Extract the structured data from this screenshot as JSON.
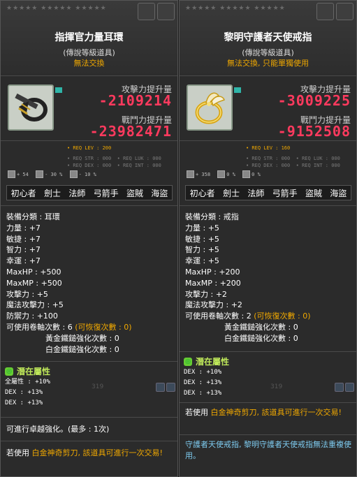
{
  "left": {
    "stars": "★★★★★ ★★★★★ ★★★★★",
    "title": "指揮官力量耳環",
    "grade": "(傳說等級道具)",
    "trade": "無法交換",
    "atk_label": "攻擊力提升量",
    "atk_value": "-2109214",
    "power_label": "戰鬥力提升量",
    "power_value": "-23982471",
    "req_lev": "• REQ LEV : 200",
    "reqs": "• REQ STR : 000  • REQ LUK : 000\n• REQ DEX : 000  • REQ INT : 000",
    "mod1": "+ 54",
    "mod2": "- 30 %",
    "mod3": "- 10 %",
    "jobs": [
      "初心者",
      "劍士",
      "法師",
      "弓箭手",
      "盜賊",
      "海盜"
    ],
    "stats": [
      "裝備分類 : 耳環",
      "力量 : +7",
      "敏捷 : +7",
      "智力 : +7",
      "幸運 : +7",
      "MaxHP : +500",
      "MaxMP : +500",
      "攻擊力 : +5",
      "魔法攻擊力 : +5",
      "防禦力 : +100"
    ],
    "scroll_label": "可使用卷軸次數 : 6 ",
    "scroll_extra": "(可恢復次數 : 0)",
    "gold_hammer": "黃金鐵鎚強化次數 : 0",
    "plat_hammer": "白金鐵鎚強化次數 : 0",
    "potential_title": "潛在屬性",
    "potential": [
      "全屬性 : +10%",
      "DEX : +13%",
      "DEX : +13%"
    ],
    "watermark": "319",
    "star_force": "可進行卓越強化。(最多 : 1次)",
    "foot_prefix": "若使用 ",
    "foot_main": "白金神奇剪刀, 該道具可進行一次交易!"
  },
  "right": {
    "stars": "★★★★★ ★★★★★ ★★★★★",
    "title": "黎明守護者天使戒指",
    "grade": "(傳說等級道具)",
    "trade": "無法交換, 只能單獨使用",
    "atk_label": "攻擊力提升量",
    "atk_value": "-3009225",
    "power_label": "戰鬥力提升量",
    "power_value": "-9152508",
    "req_lev": "• REQ LEV : 160",
    "reqs": "• REQ STR : 000  • REQ LUK : 000\n• REQ DEX : 000  • REQ INT : 000",
    "mod1": "+ 358",
    "mod2": "0 %",
    "mod3": "0 %",
    "jobs": [
      "初心者",
      "劍士",
      "法師",
      "弓箭手",
      "盜賊",
      "海盜"
    ],
    "stats": [
      "裝備分類 : 戒指",
      "力量 : +5",
      "敏捷 : +5",
      "智力 : +5",
      "幸運 : +5",
      "MaxHP : +200",
      "MaxMP : +200",
      "攻擊力 : +2",
      "魔法攻擊力 : +2"
    ],
    "scroll_label": "可使用卷軸次數 : 2 ",
    "scroll_extra": "(可恢復次數 : 0)",
    "gold_hammer": "黃金鐵鎚強化次數 : 0",
    "plat_hammer": "白金鐵鎚強化次數 : 0",
    "potential_title": "潛在屬性",
    "potential": [
      "DEX : +10%",
      "DEX : +13%",
      "DEX : +13%"
    ],
    "watermark": "319",
    "foot_prefix": "若使用 ",
    "foot_main": "白金神奇剪刀, 該道具可進行一次交易!",
    "set_note": "守護者天使戒指, 黎明守護者天使戒指無法重複使用。"
  },
  "colors": {
    "damage_red": "#ff3a5e",
    "gold": "#f0a800",
    "potential_green": "#bfe85a",
    "note_cyan": "#7ecbf0",
    "teal_flag": "#2fb5a8"
  },
  "icons": [
    "earring-icon",
    "ring-icon",
    "potential-icon",
    "star-icon"
  ]
}
